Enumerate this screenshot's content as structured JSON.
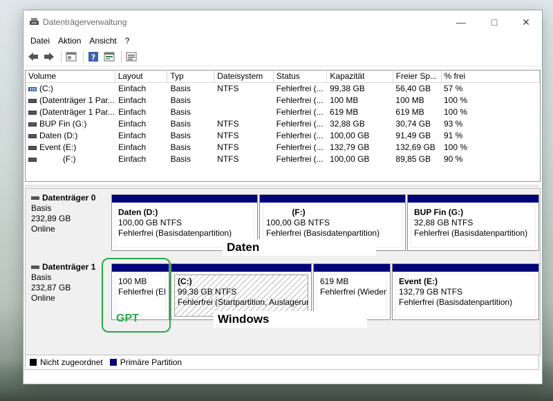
{
  "window": {
    "title": "Datenträgerverwaltung"
  },
  "menu": [
    "Datei",
    "Aktion",
    "Ansicht",
    "?"
  ],
  "toolbar": [
    "back-icon",
    "forward-icon",
    "properties-icon",
    "help-icon",
    "show-hide-icon",
    "list-icon"
  ],
  "colors": {
    "primary_partition": "#00007a",
    "unallocated": "#000000",
    "gpt_highlight": "#2aa84a"
  },
  "volumes": {
    "headers": [
      "Volume",
      "Layout",
      "Typ",
      "Dateisystem",
      "Status",
      "Kapazität",
      "Freier Sp...",
      "% frei"
    ],
    "rows": [
      {
        "icon": "striped",
        "cells": [
          "(C:)",
          "Einfach",
          "Basis",
          "NTFS",
          "Fehlerfrei (...",
          "99,38 GB",
          "56,40 GB",
          "57 %"
        ]
      },
      {
        "icon": "plain",
        "cells": [
          "(Datenträger 1 Par...",
          "Einfach",
          "Basis",
          "",
          "Fehlerfrei (...",
          "100 MB",
          "100 MB",
          "100 %"
        ]
      },
      {
        "icon": "plain",
        "cells": [
          "(Datenträger 1 Par...",
          "Einfach",
          "Basis",
          "",
          "Fehlerfrei (...",
          "619 MB",
          "619 MB",
          "100 %"
        ]
      },
      {
        "icon": "plain",
        "cells": [
          "BUP Fin (G:)",
          "Einfach",
          "Basis",
          "NTFS",
          "Fehlerfrei (...",
          "32,88 GB",
          "30,74 GB",
          "93 %"
        ]
      },
      {
        "icon": "plain",
        "cells": [
          "Daten (D:)",
          "Einfach",
          "Basis",
          "NTFS",
          "Fehlerfrei (...",
          "100,00 GB",
          "91,49 GB",
          "91 %"
        ]
      },
      {
        "icon": "plain",
        "cells": [
          "Event (E:)",
          "Einfach",
          "Basis",
          "NTFS",
          "Fehlerfrei (...",
          "132,79 GB",
          "132,69 GB",
          "100 %"
        ]
      },
      {
        "icon": "plain",
        "cells": [
          "(F:)",
          "Einfach",
          "Basis",
          "NTFS",
          "Fehlerfrei (...",
          "100,00 GB",
          "89,85 GB",
          "90 %"
        ]
      }
    ]
  },
  "disks": [
    {
      "name": "Datenträger 0",
      "type": "Basis",
      "size": "232,89 GB",
      "status": "Online",
      "partitions": [
        {
          "title": "Daten  (D:)",
          "size": "100,00 GB NTFS",
          "status": "Fehlerfrei (Basisdatenpartition)"
        },
        {
          "title": "(F:)",
          "size": "100,00 GB NTFS",
          "status": "Fehlerfrei (Basisdatenpartition)"
        },
        {
          "title": "BUP Fin  (G:)",
          "size": "32,88 GB NTFS",
          "status": "Fehlerfrei (Basisdatenpartition)"
        }
      ]
    },
    {
      "name": "Datenträger 1",
      "type": "Basis",
      "size": "232,87 GB",
      "status": "Online",
      "partitions": [
        {
          "title": "",
          "size": "100 MB",
          "status": "Fehlerfrei (EF"
        },
        {
          "title": "(C:)",
          "size": "99,38 GB NTFS",
          "status": "Fehlerfrei (Startpartition, Auslagerun"
        },
        {
          "title": "",
          "size": "619 MB",
          "status": "Fehlerfrei (Wiederh"
        },
        {
          "title": "Event  (E:)",
          "size": "132,79 GB NTFS",
          "status": "Fehlerfrei (Basisdatenpartition)"
        }
      ]
    }
  ],
  "annotations": {
    "daten": "Daten",
    "windows": "Windows",
    "gpt": "GPT"
  },
  "legend": {
    "unallocated": "Nicht zugeordnet",
    "primary": "Primäre Partition"
  }
}
